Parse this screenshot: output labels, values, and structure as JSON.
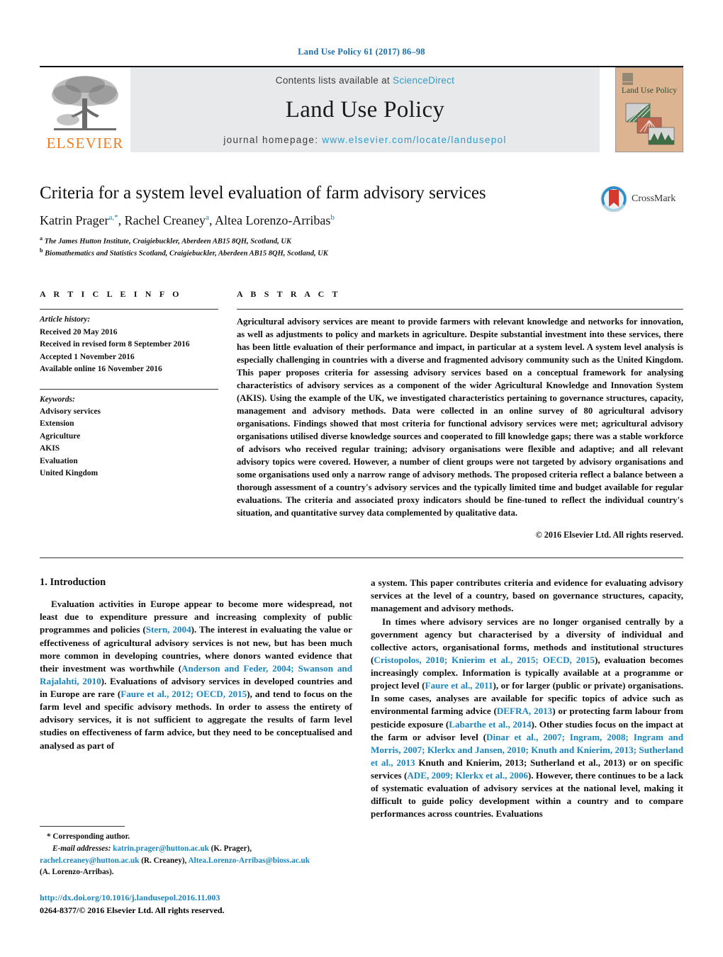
{
  "running_head": "Land Use Policy 61 (2017) 86–98",
  "masthead": {
    "publisher_name": "ELSEVIER",
    "contents_prefix": "Contents lists available at ",
    "contents_link": "ScienceDirect",
    "journal_name": "Land Use Policy",
    "homepage_prefix": "journal homepage: ",
    "homepage_url": "www.elsevier.com/locate/landusepol",
    "cover_title": "Land Use Policy"
  },
  "article": {
    "title": "Criteria for a system level evaluation of farm advisory services",
    "authors": [
      {
        "name": "Katrin Prager",
        "marks": "a,*"
      },
      {
        "name": "Rachel Creaney",
        "marks": "a"
      },
      {
        "name": "Altea Lorenzo-Arribas",
        "marks": "b"
      }
    ],
    "affiliations": [
      {
        "mark": "a",
        "text": "The James Hutton Institute, Craigiebuckler, Aberdeen AB15 8QH, Scotland, UK"
      },
      {
        "mark": "b",
        "text": "Biomathematics and Statistics Scotland, Craigiebuckler, Aberdeen AB15 8QH, Scotland, UK"
      }
    ],
    "crossmark_label": "CrossMark"
  },
  "article_info": {
    "heading": "A R T I C L E   I N F O",
    "history_label": "Article history:",
    "history": [
      "Received 20 May 2016",
      "Received in revised form 8 September 2016",
      "Accepted 1 November 2016",
      "Available online 16 November 2016"
    ],
    "keywords_label": "Keywords:",
    "keywords": [
      "Advisory services",
      "Extension",
      "Agriculture",
      "AKIS",
      "Evaluation",
      "United Kingdom"
    ]
  },
  "abstract": {
    "heading": "A B S T R A C T",
    "text": "Agricultural advisory services are meant to provide farmers with relevant knowledge and networks for innovation, as well as adjustments to policy and markets in agriculture. Despite substantial investment into these services, there has been little evaluation of their performance and impact, in particular at a system level. A system level analysis is especially challenging in countries with a diverse and fragmented advisory community such as the United Kingdom. This paper proposes criteria for assessing advisory services based on a conceptual framework for analysing characteristics of advisory services as a component of the wider Agricultural Knowledge and Innovation System (AKIS). Using the example of the UK, we investigated characteristics pertaining to governance structures, capacity, management and advisory methods. Data were collected in an online survey of 80 agricultural advisory organisations. Findings showed that most criteria for functional advisory services were met; agricultural advisory organisations utilised diverse knowledge sources and cooperated to fill knowledge gaps; there was a stable workforce of advisors who received regular training; advisory organisations were flexible and adaptive; and all relevant advisory topics were covered. However, a number of client groups were not targeted by advisory organisations and some organisations used only a narrow range of advisory methods. The proposed criteria reflect a balance between a thorough assessment of a country's advisory services and the typically limited time and budget available for regular evaluations. The criteria and associated proxy indicators should be fine-tuned to reflect the individual country's situation, and quantitative survey data complemented by qualitative data.",
    "copyright": "© 2016 Elsevier Ltd. All rights reserved."
  },
  "introduction": {
    "heading": "1.  Introduction",
    "left_paragraphs": [
      {
        "parts": [
          {
            "t": "Evaluation activities in Europe appear to become more widespread, not least due to expenditure pressure and increasing complexity of public programmes and policies (",
            "link": false
          },
          {
            "t": "Stern, 2004",
            "link": true
          },
          {
            "t": "). The interest in evaluating the value or effectiveness of agricultural advisory services is not new, but has been much more common in developing countries, where donors wanted evidence that their investment was worthwhile (",
            "link": false
          },
          {
            "t": "Anderson and Feder, 2004; Swanson and Rajalahti, 2010",
            "link": true
          },
          {
            "t": "). Evaluations of advisory services in developed countries and in Europe are rare (",
            "link": false
          },
          {
            "t": "Faure et al., 2012; OECD, 2015",
            "link": true
          },
          {
            "t": "), and tend to focus on the farm level and specific advisory methods. In order to assess the entirety of advisory services, it is not sufficient to aggregate the results of farm level studies on effectiveness of farm advice, but they need to be conceptualised and analysed as part of",
            "link": false
          }
        ]
      }
    ],
    "right_paragraphs": [
      {
        "indent": false,
        "parts": [
          {
            "t": "a system. This paper contributes criteria and evidence for evaluating advisory services at the level of a country, based on governance structures, capacity, management and advisory methods.",
            "link": false
          }
        ]
      },
      {
        "indent": true,
        "parts": [
          {
            "t": "In times where advisory services are no longer organised centrally by a government agency but characterised by a diversity of individual and collective actors, organisational forms, methods and institutional structures (",
            "link": false
          },
          {
            "t": "Cristopolos, 2010; Knierim et al., 2015; OECD, 2015",
            "link": true
          },
          {
            "t": "), evaluation becomes increasingly complex. Information is typically available at a programme or project level (",
            "link": false
          },
          {
            "t": "Faure et al., 2011",
            "link": true
          },
          {
            "t": "), or for larger (public or private) organisations. In some cases, analyses are available for specific topics of advice such as environmental farming advice (",
            "link": false
          },
          {
            "t": "DEFRA, 2013",
            "link": true
          },
          {
            "t": ") or protecting farm labour from pesticide exposure (",
            "link": false
          },
          {
            "t": "Labarthe et al., 2014",
            "link": true
          },
          {
            "t": "). Other studies focus on the impact at the farm or advisor level (",
            "link": false
          },
          {
            "t": "Dinar et al., 2007; Ingram, 2008; Ingram and Morris, 2007; Klerkx and Jansen, 2010; Knuth and Knierim, 2013; Sutherland et al., 2013",
            "link": true
          },
          {
            "t": " Knuth and Knierim, 2013; Sutherland et al., 2013) or on specific services (",
            "link": false
          },
          {
            "t": "ADE, 2009; Klerkx et al., 2006",
            "link": true
          },
          {
            "t": "). However, there continues to be a lack of systematic evaluation of advisory services at the national level, making it difficult to guide policy development within a country and to compare performances across countries. Evaluations",
            "link": false
          }
        ]
      }
    ]
  },
  "footnote": {
    "corresponding": "*  Corresponding author.",
    "email_label": "E-mail addresses:",
    "emails": [
      {
        "address": "katrin.prager@hutton.ac.uk",
        "owner": " (K. Prager),"
      },
      {
        "address": "rachel.creaney@hutton.ac.uk",
        "owner": " (R. Creaney),"
      },
      {
        "address": "Altea.Lorenzo-Arribas@bioss.ac.uk",
        "owner": ""
      }
    ],
    "last_owner": "(A. Lorenzo-Arribas).",
    "doi": "http://dx.doi.org/10.1016/j.landusepol.2016.11.003",
    "issn_line": "0264-8377/© 2016 Elsevier Ltd. All rights reserved."
  },
  "colors": {
    "link_blue": "#1a85bd",
    "sd_blue": "#2e9ccc",
    "elsevier_orange": "#f07c22",
    "cover_bg": "#ddb492",
    "cover_text": "#2d4a30"
  }
}
